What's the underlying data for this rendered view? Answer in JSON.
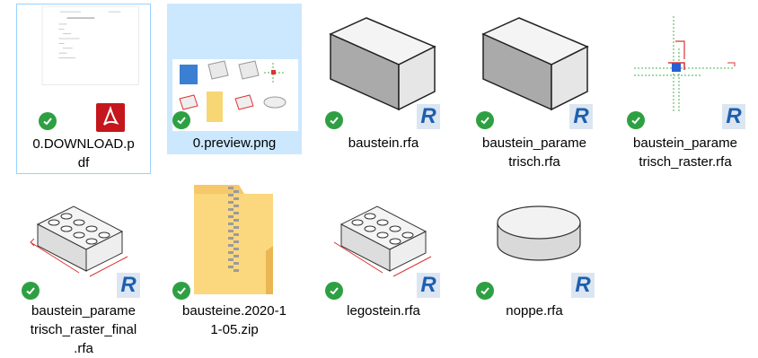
{
  "files": [
    {
      "name_l1": "0.DOWNLOAD.p",
      "name_l2": "df",
      "name_l3": "",
      "type": "pdf",
      "sync": "synced"
    },
    {
      "name_l1": "0.preview.png",
      "name_l2": "",
      "name_l3": "",
      "type": "png",
      "sync": "synced"
    },
    {
      "name_l1": "baustein.rfa",
      "name_l2": "",
      "name_l3": "",
      "type": "rfa",
      "sync": "synced"
    },
    {
      "name_l1": "baustein_parame",
      "name_l2": "trisch.rfa",
      "name_l3": "",
      "type": "rfa",
      "sync": "synced"
    },
    {
      "name_l1": "baustein_parame",
      "name_l2": "trisch_raster.rfa",
      "name_l3": "",
      "type": "rfa",
      "sync": "synced"
    },
    {
      "name_l1": "baustein_parame",
      "name_l2": "trisch_raster_final",
      "name_l3": ".rfa",
      "type": "rfa",
      "sync": "synced"
    },
    {
      "name_l1": "bausteine.2020-1",
      "name_l2": "1-05.zip",
      "name_l3": "",
      "type": "zip",
      "sync": "synced"
    },
    {
      "name_l1": "legostein.rfa",
      "name_l2": "",
      "name_l3": "",
      "type": "rfa",
      "sync": "synced"
    },
    {
      "name_l1": "noppe.rfa",
      "name_l2": "",
      "name_l3": "",
      "type": "rfa",
      "sync": "synced"
    }
  ],
  "badges": {
    "revit_letter": "R"
  },
  "colors": {
    "selection": "#cce8ff",
    "focus_border": "#99d1ff",
    "sync_ok": "#2ea043",
    "pdf_red": "#c4161c",
    "revit_blue": "#1e5fae"
  }
}
